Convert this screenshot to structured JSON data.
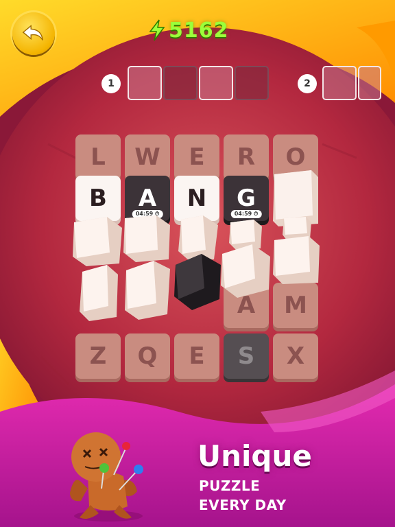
{
  "score": {
    "value": "5162"
  },
  "levels": [
    {
      "number": "1"
    },
    {
      "number": "2"
    }
  ],
  "board": {
    "row1": [
      "L",
      "W",
      "E",
      "R",
      "O"
    ],
    "word": [
      "B",
      "A",
      "N",
      "G"
    ],
    "timers": [
      "04:59",
      "04:59"
    ],
    "row4": [
      "A",
      "M"
    ],
    "row5": [
      "Z",
      "Q",
      "E",
      "S",
      "X"
    ]
  },
  "promo": {
    "headline": "Unique",
    "line1": "PUZZLE",
    "line2": "EVERY DAY"
  },
  "colors": {
    "score_green": "#9cff3a",
    "button_yellow": "#f4b400",
    "bg_magenta": "#c21b9a"
  },
  "icons": {
    "back": "back-arrow-icon",
    "bolt": "lightning-bolt-icon",
    "timer": "clock-icon"
  }
}
